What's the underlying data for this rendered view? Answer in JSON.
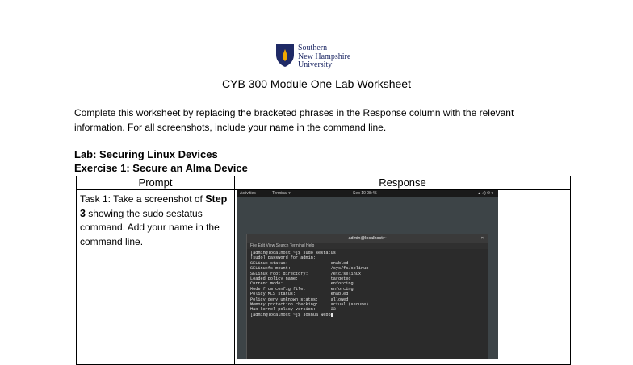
{
  "logo": {
    "line1": "Southern",
    "line2": "New Hampshire",
    "line3": "University"
  },
  "title": "CYB 300 Module One Lab Worksheet",
  "intro": "Complete this worksheet by replacing the bracketed phrases in the Response column with the relevant information. For all screenshots, include your name in the command line.",
  "lab_title": "Lab: Securing Linux Devices",
  "exercise_title": "Exercise 1: Secure an Alma Device",
  "table": {
    "headers": {
      "prompt": "Prompt",
      "response": "Response"
    },
    "task1": {
      "before": "Task 1: Take a screenshot of",
      "bold": "Step 3",
      "after": "showing the sudo sestatus command. Add your name in the command line."
    }
  },
  "screenshot": {
    "topbar": {
      "activities": "Activities",
      "terminal": "Terminal ▾",
      "clock": "Sep 10  08:45",
      "icons": "▴  ◁)  ⏻ ▾"
    },
    "terminal_title": "admin@localhost:~",
    "close_glyph": "×",
    "menu": "File   Edit   View   Search   Terminal   Help",
    "lines": [
      "[admin@localhost ~]$ sudo sestatus",
      "[sudo] password for admin:",
      "SELinux status:                 enabled",
      "SELinuxfs mount:                /sys/fs/selinux",
      "SELinux root directory:         /etc/selinux",
      "Loaded policy name:             targeted",
      "Current mode:                   enforcing",
      "Mode from config file:          enforcing",
      "Policy MLS status:              enabled",
      "Policy deny_unknown status:     allowed",
      "Memory protection checking:     actual (secure)",
      "Max kernel policy version:      33",
      "[admin@localhost ~]$ Joshua Webb"
    ]
  }
}
